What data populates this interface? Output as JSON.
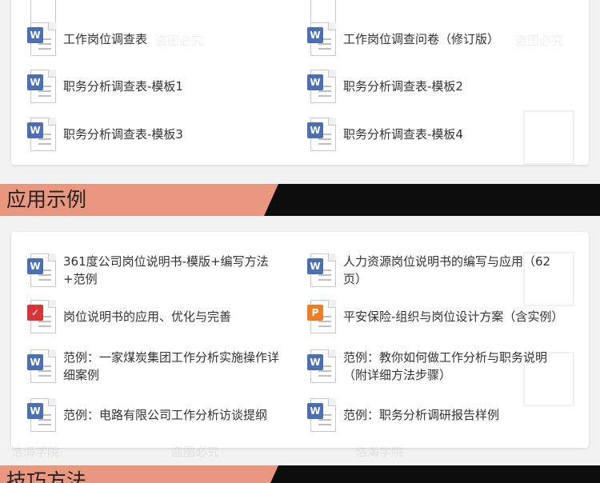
{
  "watermarks": {
    "text_a": "盗图必究",
    "text_b": "浩海学院",
    "stamp_text": "浩海学院"
  },
  "top_list": {
    "items": [
      {
        "label": "工作岗位调查表",
        "type": "word"
      },
      {
        "label": "工作岗位调查问卷（修订版）",
        "type": "word"
      },
      {
        "label": "职务分析调查表-模板1",
        "type": "word"
      },
      {
        "label": "职务分析调查表-模板2",
        "type": "word"
      },
      {
        "label": "职务分析调查表-模板3",
        "type": "word"
      },
      {
        "label": "职务分析调查表-模板4",
        "type": "word"
      }
    ]
  },
  "sections": {
    "examples_title": "应用示例",
    "tips_title": "技巧方法"
  },
  "examples_list": {
    "items": [
      {
        "label": "361度公司岗位说明书-模版+编写方法+范例",
        "type": "word"
      },
      {
        "label": "人力资源岗位说明书的编写与应用（62页）",
        "type": "word"
      },
      {
        "label": "岗位说明书的应用、优化与完善",
        "type": "pdf"
      },
      {
        "label": "平安保险-组织与岗位设计方案（含实例）",
        "type": "ppt"
      },
      {
        "label": "范例：一家煤炭集团工作分析实施操作详细案例",
        "type": "word"
      },
      {
        "label": "范例：教你如何做工作分析与职务说明（附详细方法步骤）",
        "type": "word"
      },
      {
        "label": "范例：电路有限公司工作分析访谈提纲",
        "type": "word"
      },
      {
        "label": "范例：职务分析调研报告样例",
        "type": "word"
      }
    ]
  },
  "icons": {
    "word": "W",
    "ppt": "P",
    "pdf": "✓"
  }
}
